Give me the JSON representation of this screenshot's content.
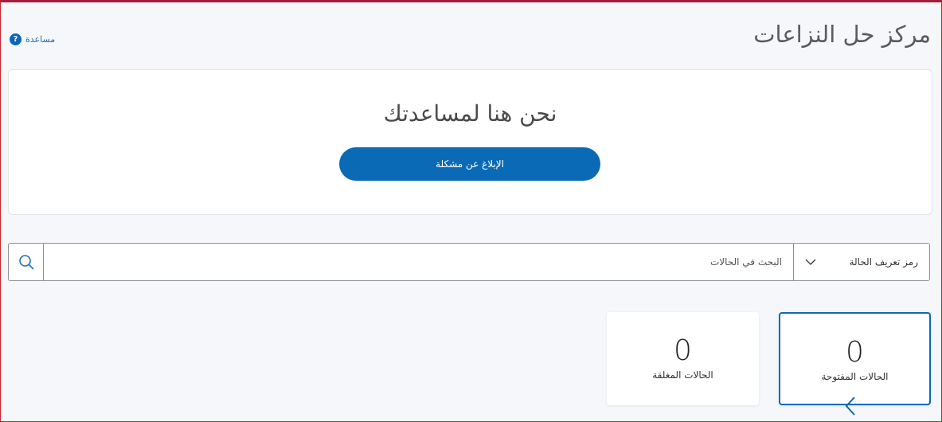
{
  "header": {
    "title": "مركز حل النزاعات",
    "help_label": "مساعدة",
    "help_glyph": "?"
  },
  "hero": {
    "heading": "نحن هنا لمساعدتك",
    "report_button_label": "الإبلاغ عن مشكلة"
  },
  "search": {
    "placeholder": "البحث في الحالات",
    "value": "",
    "type_selected": "رمز تعريف الحالة"
  },
  "cases": {
    "open": {
      "count": "0",
      "label": "الحالات المفتوحة",
      "active": true
    },
    "closed": {
      "count": "0",
      "label": "الحالات المغلقة",
      "active": false
    }
  },
  "colors": {
    "accent": "#0a6ab6",
    "frame_border": "#c9242b"
  },
  "icons": [
    "help-icon",
    "search-icon",
    "chevron-down-icon",
    "chevron-left-icon"
  ]
}
